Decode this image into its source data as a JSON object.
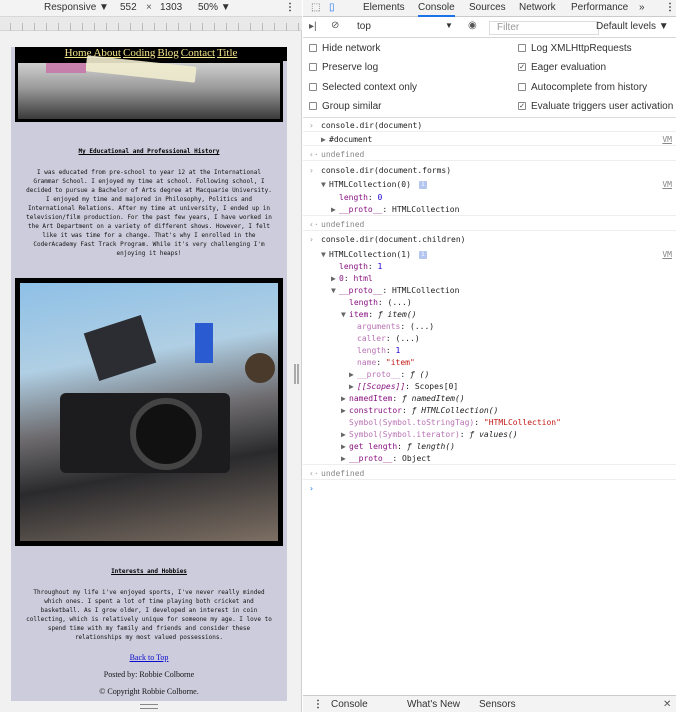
{
  "devbar": {
    "device": "Responsive ▼",
    "width": "552",
    "height": "1303",
    "zoom": "50% ▼"
  },
  "page": {
    "nav": [
      "Home",
      "About",
      "Coding",
      "Blog",
      "Contact",
      "Title"
    ],
    "section1_title": "My Educational and Professional History",
    "section1_text": "I was educated from pre-school to year 12 at the International Grammar School. I enjoyed my time at school. Following school, I decided to pursue a Bachelor of Arts degree at Macquarie University. I enjoyed my time and majored in Philosophy, Politics and International Relations. After my time at university, I ended up in television/film production. For the past few years, I have worked in the Art Department on a variety of different shows. However, I felt like it was time for a change. That's why I enrolled in the CoderAcademy Fast Track Program. While it's very challenging I'm enjoying it heaps!",
    "section2_title": "Interests and Hobbies",
    "section2_text": "Throughout my life i've enjoyed sports, I've never really minded which ones. I spent a lot of time playing both cricket and basketball. As I grow older, I developed an interest in coin collecting, which is relatively unique for someone my age. I love to spend time with my family and friends and consider these relationships my most valued possessions.",
    "back_to_top": "Back to Top",
    "posted_by": "Posted by: Robbie Colborne",
    "copyright": "© Copyright Robbie Colborne."
  },
  "devtools": {
    "tabs": [
      "Elements",
      "Console",
      "Sources",
      "Network",
      "Performance",
      "»"
    ],
    "active_tab": "Console",
    "context": "top",
    "filter_placeholder": "Filter",
    "levels": "Default levels ▼",
    "settings_left": [
      {
        "label": "Hide network",
        "checked": false
      },
      {
        "label": "Preserve log",
        "checked": false
      },
      {
        "label": "Selected context only",
        "checked": false
      },
      {
        "label": "Group similar",
        "checked": false
      }
    ],
    "settings_right": [
      {
        "label": "Log XMLHttpRequests",
        "checked": false
      },
      {
        "label": "Eager evaluation",
        "checked": true
      },
      {
        "label": "Autocomplete from history",
        "checked": false
      },
      {
        "label": "Evaluate triggers user activation",
        "checked": true
      }
    ],
    "drawer_tabs": [
      "Console",
      "What's New",
      "Sensors"
    ],
    "vm_link": "VM",
    "console": {
      "cmd1": "console.dir(document)",
      "obj1": "#document",
      "undef": "undefined",
      "cmd2": "console.dir(document.forms)",
      "coll0": "HTMLCollection(0)",
      "length0": "0",
      "proto_hc": "HTMLCollection",
      "cmd3": "console.dir(document.children)",
      "coll1": "HTMLCollection(1)",
      "length1": "1",
      "child0": "html",
      "len_ellipsis": "(...)",
      "item_sig": "item()",
      "arguments": "(...)",
      "caller": "(...)",
      "item_length": "1",
      "item_name": "\"item\"",
      "proto_f": "ƒ ()",
      "scopes": "Scopes[0]",
      "namedItem": "namedItem()",
      "constructor": "HTMLCollection()",
      "toStringTag": "\"HTMLCollection\"",
      "iterator": "values()",
      "getlength": "length()",
      "proto_obj": "Object"
    }
  }
}
